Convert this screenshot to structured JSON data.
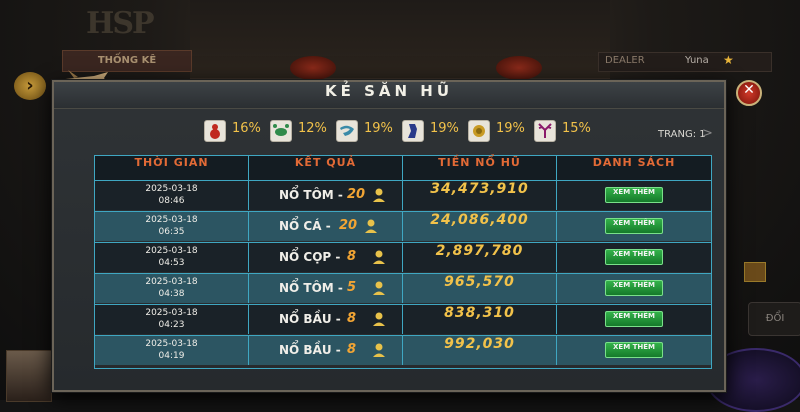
{
  "background": {
    "stats_tab_label": "THỐNG KÊ",
    "dealer_label": "DEALER",
    "dealer_name": "Yuna",
    "side_button_label": "ĐỔI"
  },
  "modal": {
    "title": "KẺ SĂN HŨ",
    "close_symbol": "✕"
  },
  "stats": [
    {
      "icon": "gourd-icon",
      "color": "#c0281e",
      "pct": "16%"
    },
    {
      "icon": "crab-icon",
      "color": "#2f8a4a",
      "pct": "12%"
    },
    {
      "icon": "shrimp-icon",
      "color": "#3a8aa8",
      "pct": "19%"
    },
    {
      "icon": "tiger-icon",
      "color": "#2a3a8a",
      "pct": "19%"
    },
    {
      "icon": "fish-icon",
      "color": "#c89a24",
      "pct": "19%"
    },
    {
      "icon": "rooster-icon",
      "color": "#8a1a6a",
      "pct": "15%"
    }
  ],
  "pagination": {
    "label": "TRANG: 1",
    "next_symbol": ">"
  },
  "table": {
    "headers": [
      "THỜI GIAN",
      "KẾT QUẢ",
      "TIỀN NỔ HŨ",
      "DANH SÁCH"
    ],
    "rows": [
      {
        "date": "2025-03-18",
        "time": "08:46",
        "label": "NỔ TÔM -",
        "count": "20",
        "amount": "34,473,910",
        "button": "XEM THÊM"
      },
      {
        "date": "2025-03-18",
        "time": "06:35",
        "label": "NỔ CÁ -",
        "count": "20",
        "amount": "24,086,400",
        "button": "XEM THÊM"
      },
      {
        "date": "2025-03-18",
        "time": "04:53",
        "label": "NỔ CỌP -",
        "count": "8",
        "amount": "2,897,780",
        "button": "XEM THÊM"
      },
      {
        "date": "2025-03-18",
        "time": "04:38",
        "label": "NỔ TÔM -",
        "count": "5",
        "amount": "965,570",
        "button": "XEM THÊM"
      },
      {
        "date": "2025-03-18",
        "time": "04:23",
        "label": "NỔ BẦU -",
        "count": "8",
        "amount": "838,310",
        "button": "XEM THÊM"
      },
      {
        "date": "2025-03-18",
        "time": "04:19",
        "label": "NỔ BẦU -",
        "count": "8",
        "amount": "992,030",
        "button": "XEM THÊM"
      }
    ]
  }
}
